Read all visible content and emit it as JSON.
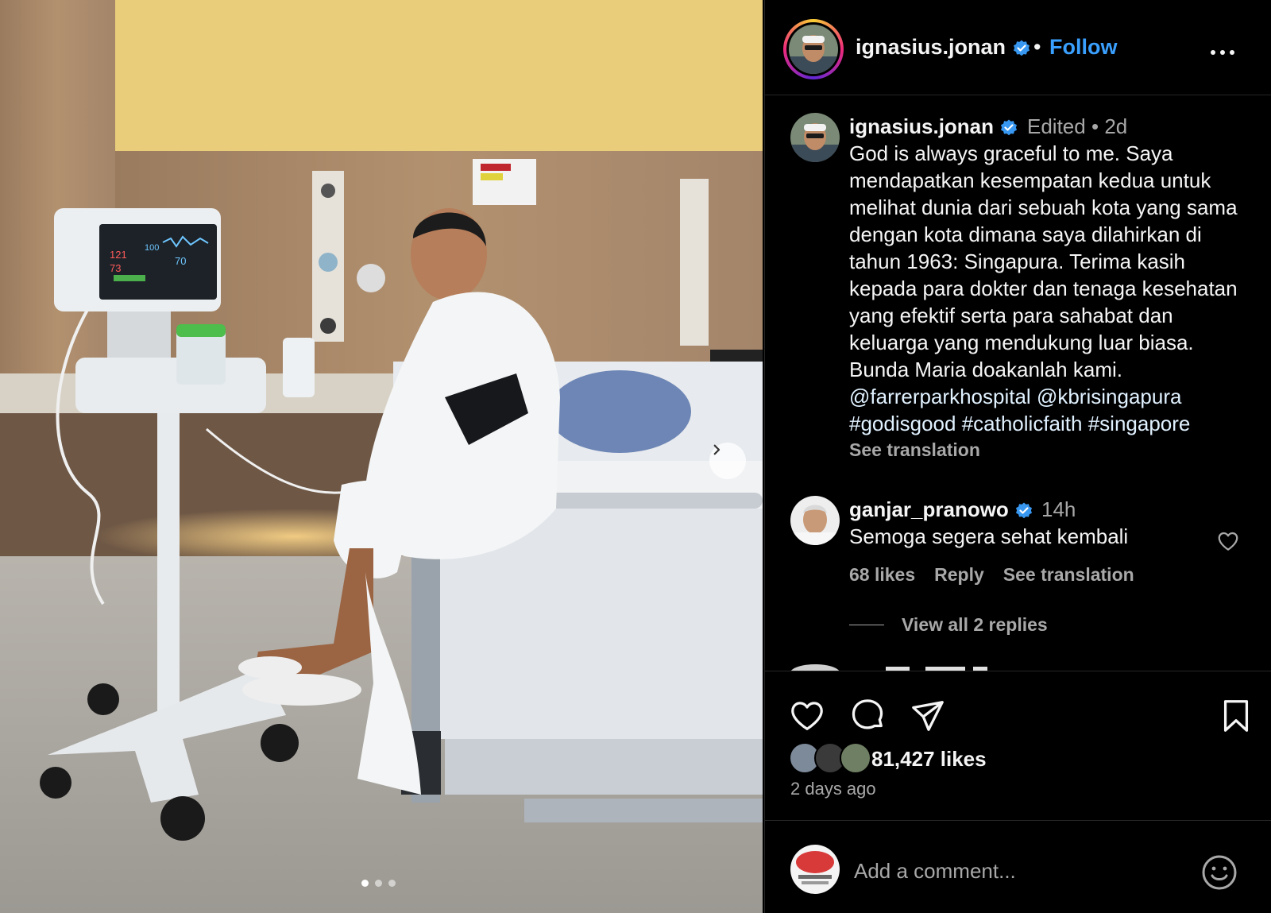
{
  "post": {
    "username": "ignasius.jonan",
    "follow_label": "Follow",
    "separator": "•"
  },
  "caption": {
    "username": "ignasius.jonan",
    "edited": "Edited",
    "time": "2d",
    "text": "God is always graceful to me. Saya mendapatkan kesempatan kedua untuk melihat dunia dari sebuah kota yang sama dengan kota dimana saya dilahirkan di tahun 1963: Singapura. Terima kasih kepada para dokter dan tenaga kesehatan yang efektif serta para sahabat dan keluarga yang mendukung luar biasa. Bunda Maria doakanlah kami.",
    "mentions": [
      "@farrerparkhospital",
      "@kbrisingapura"
    ],
    "hashtags": [
      "#godisgood",
      "#catholicfaith",
      "#singapore"
    ],
    "see_translation": "See translation"
  },
  "comment": {
    "username": "ganjar_pranowo",
    "time": "14h",
    "text": "Semoga segera sehat kembali",
    "likes": "68 likes",
    "reply": "Reply",
    "see_translation": "See translation",
    "view_replies": "View all 2 replies"
  },
  "engagement": {
    "likes": "81,427 likes",
    "time_ago": "2 days ago"
  },
  "add_comment": {
    "placeholder": "Add a comment..."
  },
  "carousel": {
    "slides": 3,
    "active_index": 0
  },
  "icons": {
    "verified": "verified-badge-icon",
    "more": "more-options-icon",
    "like": "heart-icon",
    "comment": "comment-icon",
    "share": "send-icon",
    "save": "bookmark-icon",
    "emoji": "emoji-icon",
    "next": "chevron-right-icon"
  },
  "colors": {
    "link_blue": "#3aa0ff",
    "verified_blue": "#3897f0",
    "muted_text": "#a8a8a8",
    "background": "#000000"
  }
}
